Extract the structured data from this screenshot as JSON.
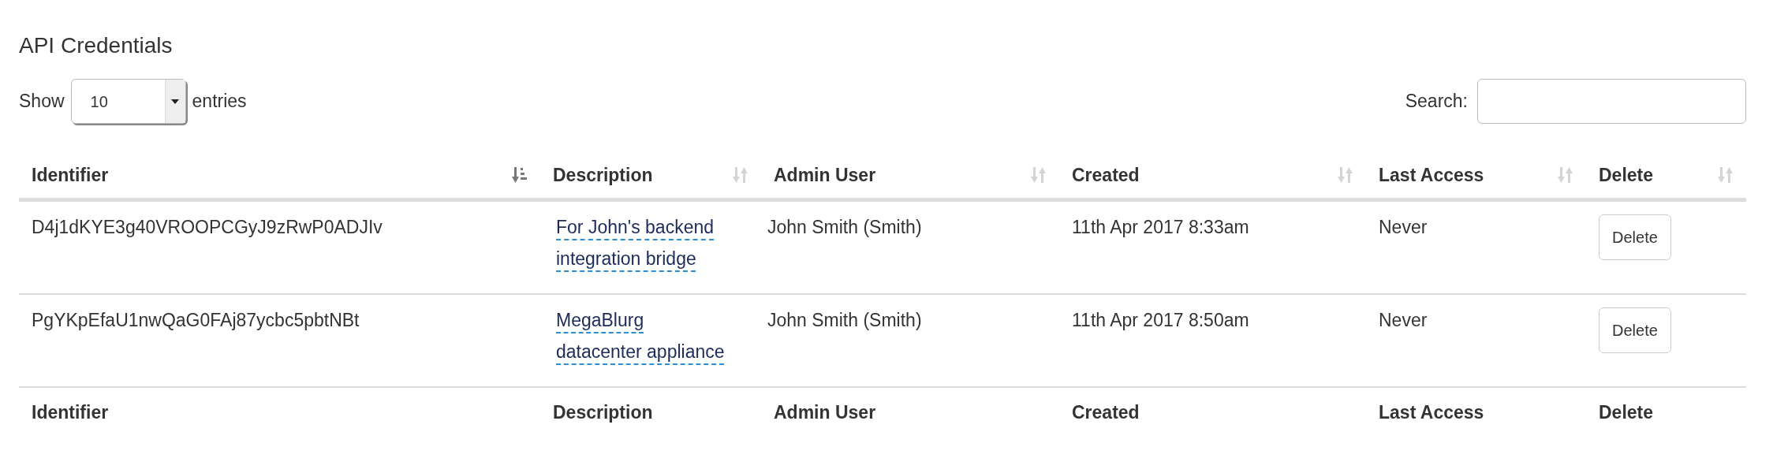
{
  "title": "API Credentials",
  "length_menu": {
    "before": "Show",
    "value": "10",
    "after": "entries"
  },
  "search": {
    "label": "Search:"
  },
  "table": {
    "columns": [
      {
        "label": "Identifier",
        "sorted": true
      },
      {
        "label": "Description",
        "sorted": false
      },
      {
        "label": "Admin User",
        "sorted": false
      },
      {
        "label": "Created",
        "sorted": false
      },
      {
        "label": "Last Access",
        "sorted": false
      },
      {
        "label": "Delete",
        "sorted": false
      }
    ],
    "rows": [
      {
        "identifier": "D4j1dKYE3g40VROOPCGyJ9zRwP0ADJIv",
        "description": "For John's backend integration bridge",
        "admin_user": "John Smith (Smith)",
        "created": "11th Apr 2017 8:33am",
        "last_access": "Never",
        "action": "Delete"
      },
      {
        "identifier": "PgYKpEfaU1nwQaG0FAj87ycbc5pbtNBt",
        "description": "MegaBlurg datacenter appliance",
        "admin_user": "John Smith (Smith)",
        "created": "11th Apr 2017 8:50am",
        "last_access": "Never",
        "action": "Delete"
      }
    ],
    "footer": [
      "Identifier",
      "Description",
      "Admin User",
      "Created",
      "Last Access",
      "Delete"
    ]
  }
}
